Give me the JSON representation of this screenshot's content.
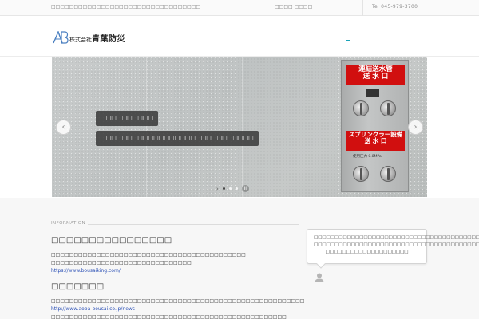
{
  "topbar": {
    "tagline": "□□□□□□□□□□□□□□□□□□□□□□□□□□□□□□□□□",
    "links": "□□□□ □□□□",
    "tel": "Tel 045-979-3700"
  },
  "header": {
    "logo_mark": "AB",
    "company_prefix": "株式会社",
    "company_name": "青葉防災"
  },
  "slider": {
    "caption_1": "□□□□□□□□□□",
    "caption_2": "□□□□□□□□□□□□□□□□□□□□□□□□□□□□□",
    "sign_1_line1": "連結送水管",
    "sign_1_line2": "送 水 口",
    "sign_2_line1": "スプリンクラー設備",
    "sign_2_line2": "送 水 口",
    "panel_note": "使用圧力 0.8MPa",
    "prev_symbol": "‹",
    "next_symbol": "›",
    "pager_symbol": "›",
    "pause_symbol": "II",
    "active_slide": 1,
    "slide_count": 3
  },
  "content": {
    "section_label": "INFORMATION",
    "news_1": {
      "title": "□□□□□□□□□□□□□□□□",
      "line_1": "□□□□□□□□□□□□□□□□□□□□□□□□□□□□□□□□□□□□□□□□□□□",
      "line_2": "□□□□□□□□□□□□□□□□□□□□□□□□□□□□□□□",
      "link": "https://www.bousaiking.com/"
    },
    "news_2": {
      "title": "□□□□□□□",
      "line_1": "□□□□□□□□□□□□□□□□□□□□□□□□□□□□□□□□□□□□□□□□□□□□□□□□□□□□□□□□",
      "link": "http://www.aoba-bousai.co.jp/news",
      "line_2": "□□□□□□□□□□□□□□□□□□□□□□□□□□□□□□□□□□□□□□□□□□□□□□□□□□□□"
    },
    "bubble": {
      "line_1": "□□□□□□□□□□□□□□□□□□□□□□□□□□□□□□□□□□□□□□□□□□",
      "line_2": "□□□□□□□□□□□□□□□□□□□□□□□□□□□□□□□□□□□□□□□□□□",
      "line_3": "□□□□□□□□□□□□□□□□□□□□"
    }
  },
  "colors": {
    "accent": "#1aa3b8",
    "sign_red": "#d10f0f",
    "link_blue": "#2a4fb5"
  }
}
